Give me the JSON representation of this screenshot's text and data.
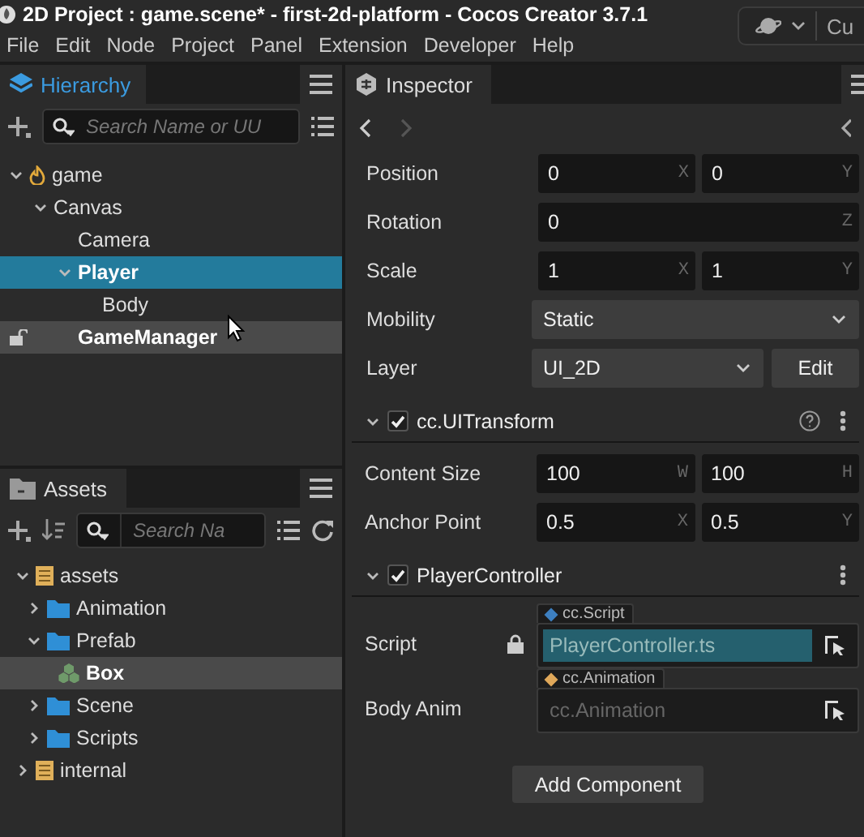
{
  "window": {
    "title": "2D Project : game.scene* - first-2d-platform - Cocos Creator 3.7.1"
  },
  "toolbar_button": {
    "label": "Cu"
  },
  "menu": [
    "File",
    "Edit",
    "Node",
    "Project",
    "Panel",
    "Extension",
    "Developer",
    "Help"
  ],
  "hierarchy": {
    "tab": "Hierarchy",
    "search": {
      "placeholder": "Search Name or UU"
    },
    "tree": [
      {
        "label": "game",
        "kind": "scene",
        "expanded": true,
        "selected": false,
        "hovered": false,
        "children": [
          {
            "label": "Canvas",
            "expanded": true,
            "selected": false,
            "hovered": false,
            "children": [
              {
                "label": "Camera",
                "selected": false,
                "hovered": false
              },
              {
                "label": "Player",
                "expanded": true,
                "selected": true,
                "hovered": false,
                "children": [
                  {
                    "label": "Body",
                    "selected": false,
                    "hovered": false
                  }
                ]
              },
              {
                "label": "GameManager",
                "selected": false,
                "hovered": true
              }
            ]
          }
        ]
      }
    ]
  },
  "assets": {
    "tab": "Assets",
    "search": {
      "placeholder": "Search Na"
    },
    "tree": [
      {
        "label": "assets",
        "kind": "database",
        "expanded": true,
        "selected": false,
        "children": [
          {
            "label": "Animation",
            "kind": "folder",
            "expanded": false,
            "selected": false
          },
          {
            "label": "Prefab",
            "kind": "folder",
            "expanded": true,
            "selected": false,
            "children": [
              {
                "label": "Box",
                "kind": "prefab",
                "selected": true
              }
            ]
          },
          {
            "label": "Scene",
            "kind": "folder",
            "expanded": false,
            "selected": false
          },
          {
            "label": "Scripts",
            "kind": "folder",
            "expanded": false,
            "selected": false
          }
        ]
      },
      {
        "label": "internal",
        "kind": "database",
        "expanded": false,
        "selected": false
      }
    ]
  },
  "inspector": {
    "tab": "Inspector",
    "node_props": [
      {
        "label": "Position",
        "kind": "fields",
        "fields": [
          {
            "value": "0",
            "axis": "X"
          },
          {
            "value": "0",
            "axis": "Y"
          }
        ]
      },
      {
        "label": "Rotation",
        "kind": "fields",
        "fields": [
          {
            "value": "0",
            "axis": "Z"
          }
        ]
      },
      {
        "label": "Scale",
        "kind": "fields",
        "fields": [
          {
            "value": "1",
            "axis": "X"
          },
          {
            "value": "1",
            "axis": "Y"
          }
        ]
      },
      {
        "label": "Mobility",
        "kind": "select",
        "value": "Static"
      },
      {
        "label": "Layer",
        "kind": "select",
        "value": "UI_2D",
        "button": "Edit"
      }
    ],
    "components": [
      {
        "name": "cc.UITransform",
        "enabled": true,
        "help": true,
        "props": [
          {
            "label": "Content Size",
            "kind": "fields",
            "fields": [
              {
                "value": "100",
                "axis": "W"
              },
              {
                "value": "100",
                "axis": "H"
              }
            ]
          },
          {
            "label": "Anchor Point",
            "kind": "fields",
            "fields": [
              {
                "value": "0.5",
                "axis": "X"
              },
              {
                "value": "0.5",
                "axis": "Y"
              }
            ]
          }
        ]
      },
      {
        "name": "PlayerController",
        "enabled": true,
        "props": [
          {
            "label": "Script",
            "kind": "asset",
            "type": "cc.Script",
            "color": "#3d7fc0",
            "locked": true,
            "value": "PlayerController.ts"
          },
          {
            "label": "Body Anim",
            "kind": "asset",
            "type": "cc.Animation",
            "color": "#e0a85a",
            "placeholder": "cc.Animation"
          }
        ]
      }
    ],
    "add_button": "Add Component"
  }
}
